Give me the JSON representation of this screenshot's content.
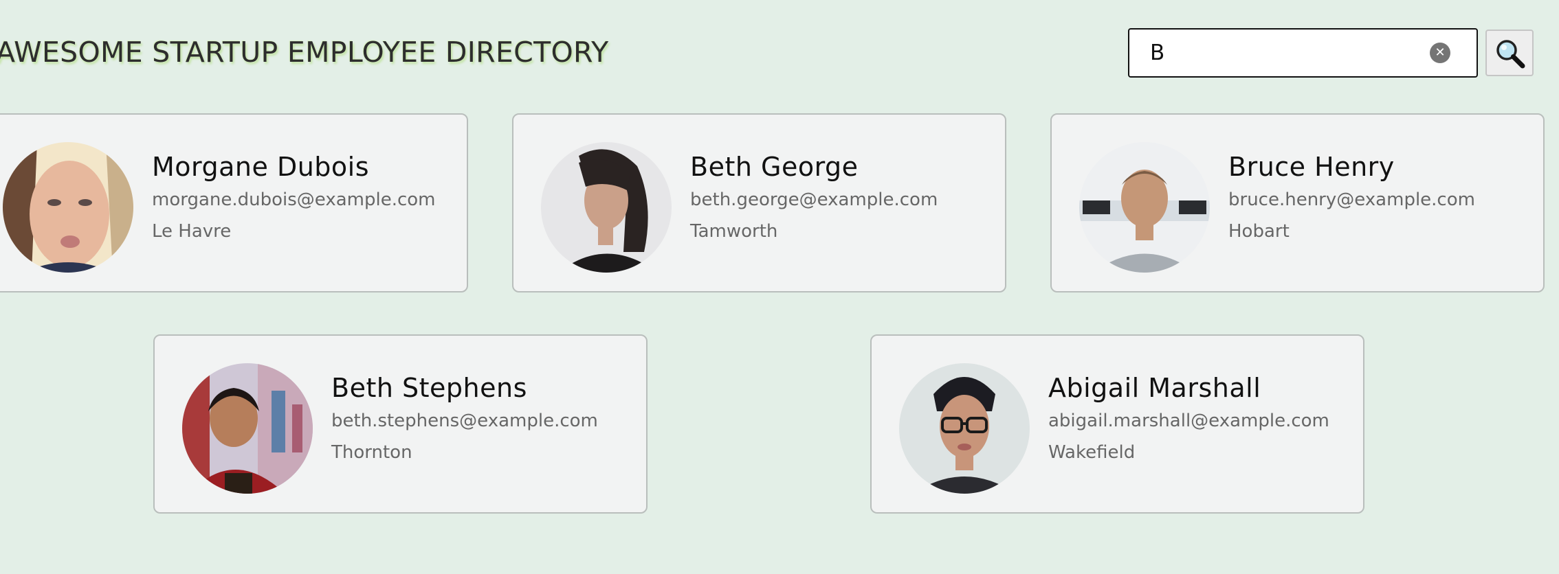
{
  "header": {
    "title": "AWESOME STARTUP EMPLOYEE DIRECTORY"
  },
  "search": {
    "value": "B",
    "clear_icon": "clear-circle-icon",
    "button_icon": "magnifier-icon"
  },
  "employees": [
    {
      "name": "Morgane Dubois",
      "email": "morgane.dubois@example.com",
      "city": "Le Havre"
    },
    {
      "name": "Beth George",
      "email": "beth.george@example.com",
      "city": "Tamworth"
    },
    {
      "name": "Bruce Henry",
      "email": "bruce.henry@example.com",
      "city": "Hobart"
    },
    {
      "name": "Beth Stephens",
      "email": "beth.stephens@example.com",
      "city": "Thornton"
    },
    {
      "name": "Abigail Marshall",
      "email": "abigail.marshall@example.com",
      "city": "Wakefield"
    }
  ],
  "colors": {
    "background": "#e3efe7",
    "card": "#f2f3f3",
    "title_glow": "#c2e3a2"
  }
}
